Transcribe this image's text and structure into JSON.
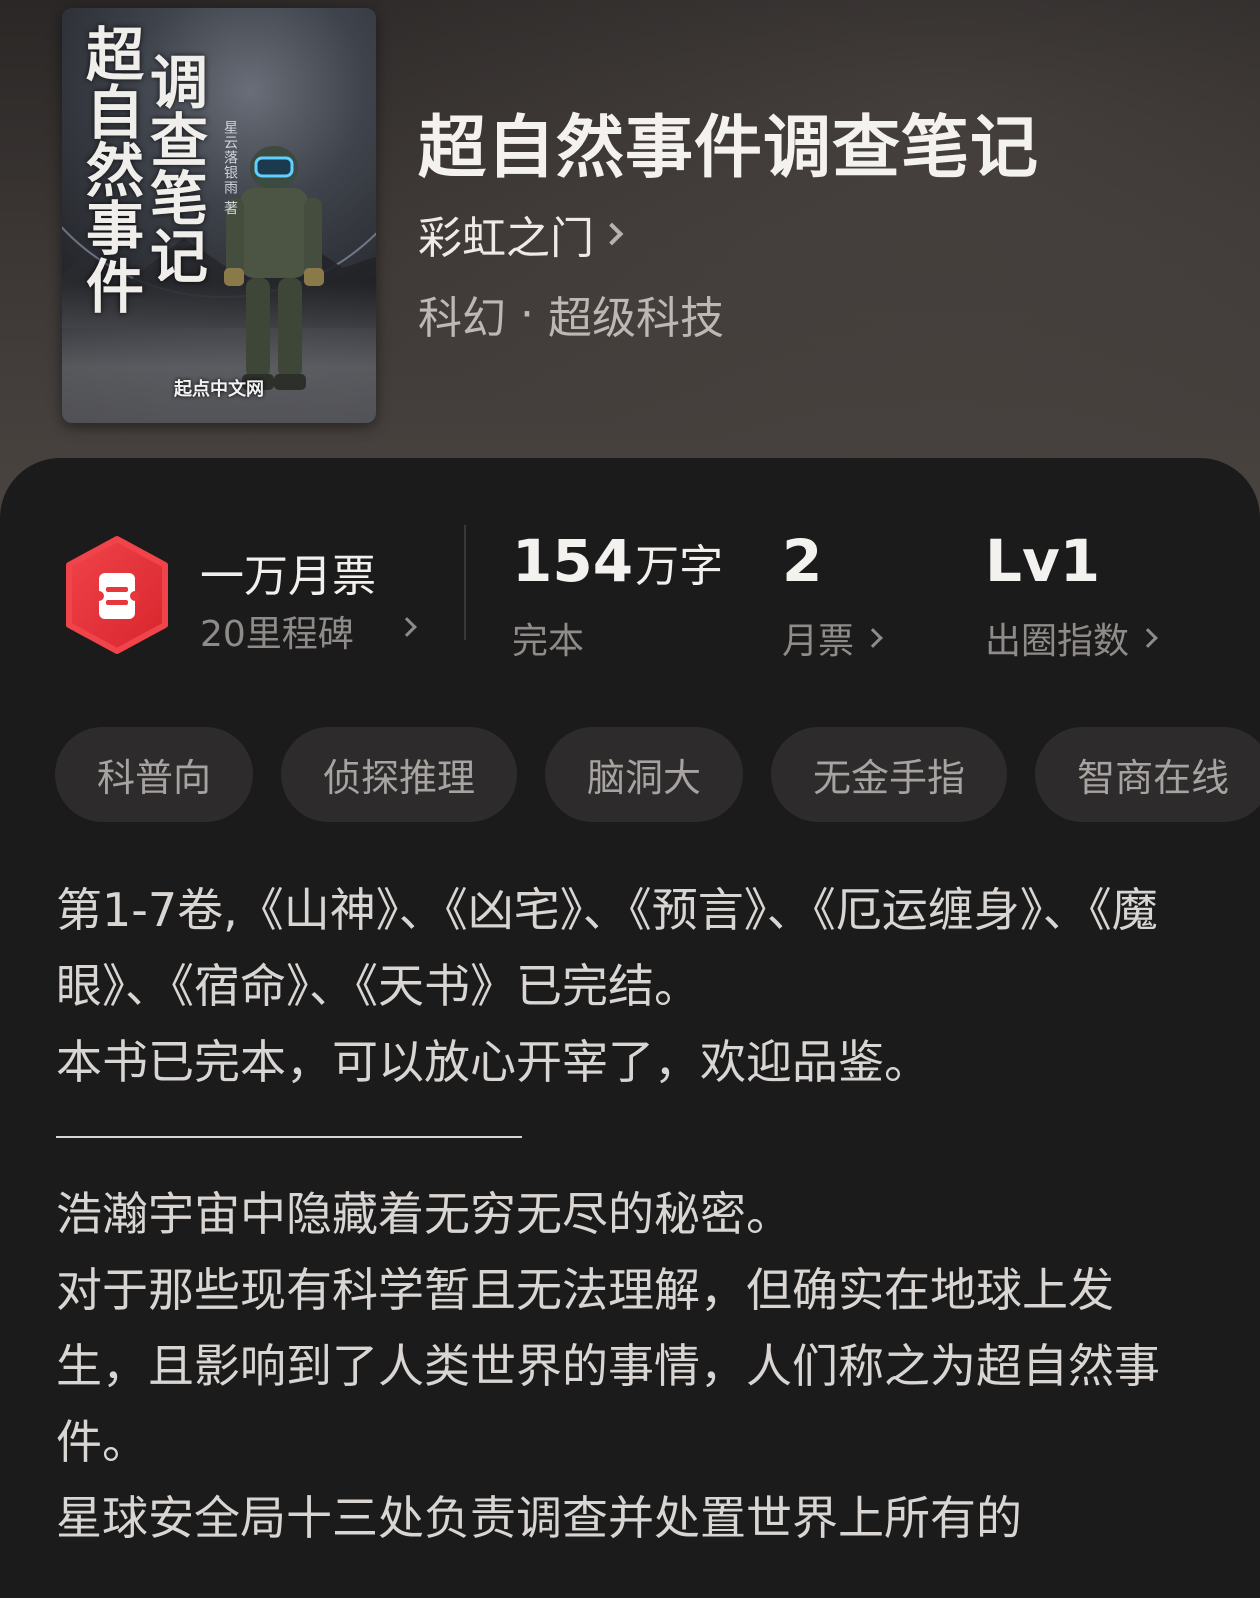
{
  "book": {
    "cover": {
      "title_line1": "调查笔记",
      "title_line2": "超自然事件",
      "author_vertical": "星云落银雨 著",
      "publisher": "起点中文网"
    },
    "title": "超自然事件调查笔记",
    "author": "彩虹之门",
    "genre_main": "科幻",
    "genre_separator": "·",
    "genre_sub": "超级科技"
  },
  "stats": {
    "milestone_title": "一万月票",
    "milestone_sub": "20里程碑",
    "word_count": "154",
    "word_unit": "万字",
    "status": "完本",
    "monthly_tickets": "2",
    "monthly_tickets_label": "月票",
    "level": "Lv1",
    "level_label": "出圈指数"
  },
  "tags": [
    "科普向",
    "侦探推理",
    "脑洞大",
    "无金手指",
    "智商在线"
  ],
  "description": {
    "para1": "第1-7卷,《山神》、《凶宅》、《预言》、《厄运缠身》、《魔眼》、《宿命》、《天书》已完结。",
    "para2": "本书已完本，可以放心开宰了，欢迎品鉴。",
    "para3": "浩瀚宇宙中隐藏着无穷无尽的秘密。",
    "para4": "对于那些现有科学暂且无法理解，但确实在地球上发生，且影响到了人类世界的事情，人们称之为超自然事件。",
    "para5": "星球安全局十三处负责调查并处置世界上所有的"
  },
  "colors": {
    "badge_red": "#ea3a3f",
    "tag_bg": "#2d2b2b",
    "panel_bg": "#1c1b1c"
  }
}
